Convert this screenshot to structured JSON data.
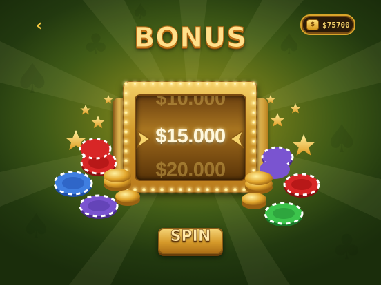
{
  "header": {
    "back_icon": "chevron-left-icon",
    "balance": {
      "icon": "coin-icon",
      "value": "$75700"
    }
  },
  "title": "BONUS",
  "slot": {
    "prev_value": "$10.000",
    "current_value": "$15.000",
    "next_value": "$20.000"
  },
  "spin_button": {
    "label": "SPIN"
  },
  "colors": {
    "background": "#3f5a16",
    "gold": "#d19a2a",
    "title": "#ffe08a"
  },
  "decorations": [
    "star-icon",
    "poker-chip-red",
    "poker-chip-blue",
    "poker-chip-purple",
    "poker-chip-green",
    "gold-coin-stack"
  ]
}
